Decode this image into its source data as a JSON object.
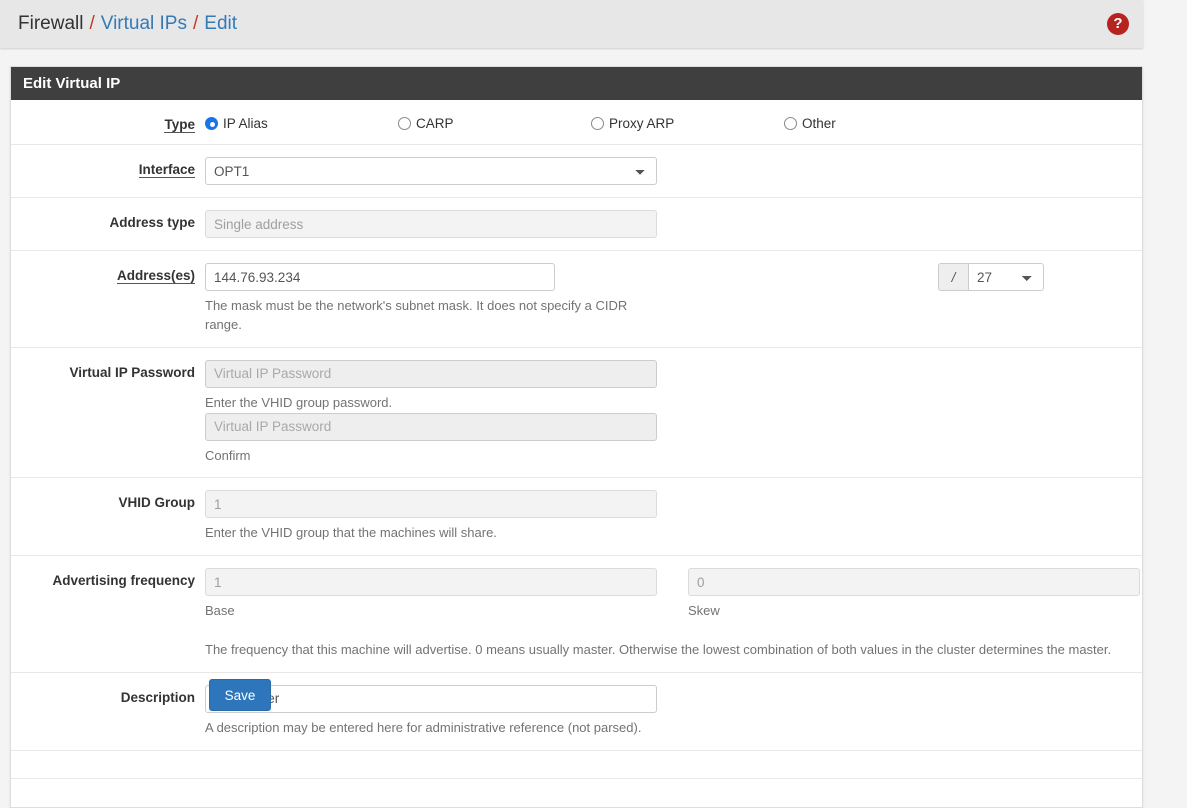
{
  "breadcrumb": {
    "root": "Firewall",
    "separator": "/",
    "section": "Virtual IPs",
    "current": "Edit",
    "help_icon": "question-circle-icon",
    "help_glyph": "?"
  },
  "panel": {
    "title": "Edit Virtual IP"
  },
  "form": {
    "type": {
      "label": "Type",
      "options": [
        {
          "label": "IP Alias",
          "checked": true
        },
        {
          "label": "CARP",
          "checked": false
        },
        {
          "label": "Proxy ARP",
          "checked": false
        },
        {
          "label": "Other",
          "checked": false
        }
      ]
    },
    "interface": {
      "label": "Interface",
      "value": "OPT1",
      "disabled": false
    },
    "address_type": {
      "label": "Address type",
      "value": "Single address",
      "disabled": true
    },
    "addresses": {
      "label": "Address(es)",
      "value": "144.76.93.234",
      "placeholder": "",
      "help": "The mask must be the network's subnet mask. It does not specify a CIDR range.",
      "cidr_prefix": "/",
      "cidr_value": "27"
    },
    "vip_password": {
      "label": "Virtual IP Password",
      "placeholder": "Virtual IP Password",
      "value": "",
      "help": "Enter the VHID group password.",
      "confirm_placeholder": "Virtual IP Password",
      "confirm_value": "",
      "confirm_help": "Confirm"
    },
    "vhid_group": {
      "label": "VHID Group",
      "value": "1",
      "help": "Enter the VHID group that the machines will share."
    },
    "advertising_frequency": {
      "label": "Advertising frequency",
      "base_value": "1",
      "base_help": "Base",
      "skew_value": "0",
      "skew_help": "Skew",
      "help": "The frequency that this machine will advertise. 0 means usually master. Otherwise the lowest combination of both values in the cluster determines the master."
    },
    "description": {
      "label": "Description",
      "value": "Safeserver",
      "help": "A description may be entered here for administrative reference (not parsed)."
    }
  },
  "actions": {
    "save_label": "Save"
  },
  "colors": {
    "accent_link": "#337ab7",
    "separator_red": "#c0392b",
    "help_red": "#b7241f",
    "panel_header": "#3f3f3f",
    "radio_blue": "#1a73e8",
    "save_blue": "#2d76bb"
  }
}
